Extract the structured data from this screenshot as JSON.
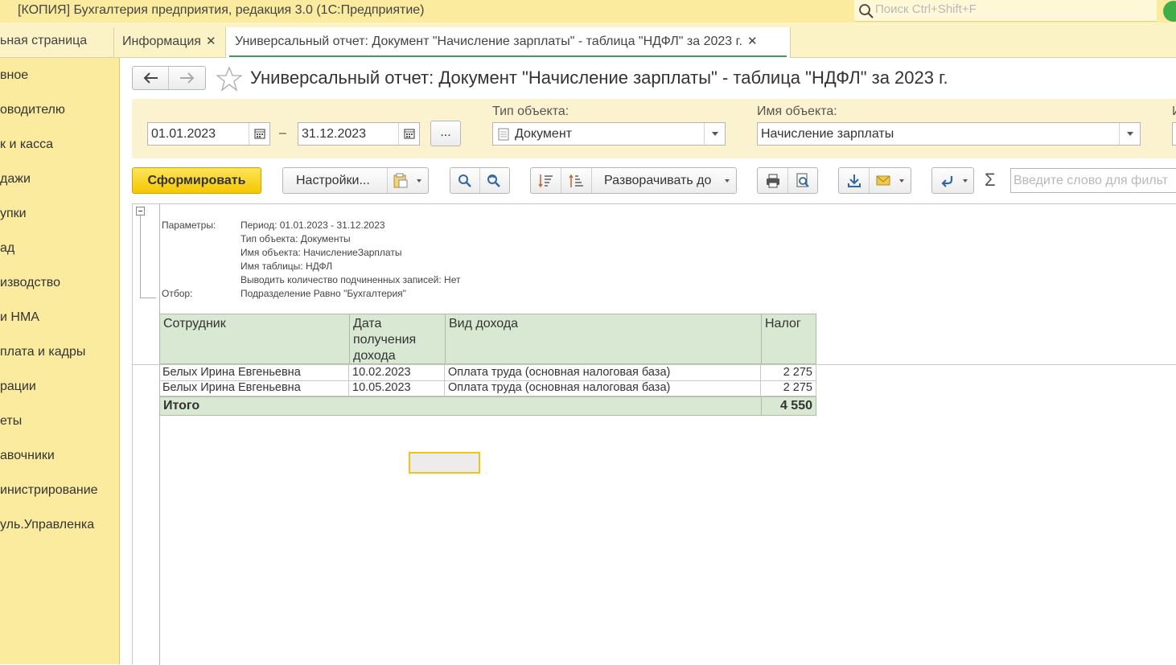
{
  "window": {
    "title": "[КОПИЯ] Бухгалтерия предприятия, редакция 3.0  (1С:Предприятие)",
    "search_placeholder": "Поиск Ctrl+Shift+F"
  },
  "tabs": [
    {
      "label": "ьная страница"
    },
    {
      "label": "Информация",
      "close": "✕"
    },
    {
      "label": "Универсальный отчет: Документ \"Начисление зарплаты\" - таблица \"НДФЛ\" за 2023 г.",
      "close": "✕",
      "active": true
    }
  ],
  "sidebar": {
    "items": [
      {
        "label": "вное"
      },
      {
        "label": "оводителю"
      },
      {
        "label": "к и касса"
      },
      {
        "label": "дажи"
      },
      {
        "label": "упки"
      },
      {
        "label": "ад"
      },
      {
        "label": "изводство"
      },
      {
        "label": "и НМА"
      },
      {
        "label": "плата и кадры"
      },
      {
        "label": "рации"
      },
      {
        "label": "еты"
      },
      {
        "label": "авочники"
      },
      {
        "label": "инистрирование"
      },
      {
        "label": "уль.Управленка"
      }
    ]
  },
  "report": {
    "title": "Универсальный отчет: Документ \"Начисление зарплаты\" - таблица \"НДФЛ\" за 2023 г.",
    "params": {
      "date_from": "01.01.2023",
      "date_separator": "–",
      "date_to": "31.12.2023",
      "more_button": "...",
      "object_type_label": "Тип объекта:",
      "object_type_value": "Документ",
      "object_name_label": "Имя объекта:",
      "object_name_value": "Начисление зарплаты",
      "cut_label": "И"
    },
    "toolbar": {
      "generate": "Сформировать",
      "settings": "Настройки...",
      "expand_to": "Разворачивать до",
      "filter_placeholder": "Введите слово для фильт",
      "sigma": "Σ"
    },
    "header_block": {
      "params_label": "Параметры:",
      "filter_label": "Отбор:",
      "lines": [
        "Период: 01.01.2023 - 31.12.2023",
        "Тип объекта: Документы",
        "Имя объекта: НачислениеЗарплаты",
        "Имя таблицы: НДФЛ",
        "Выводить количество подчиненных записей: Нет"
      ],
      "filter_value": "Подразделение Равно \"Бухгалтерия\""
    },
    "table": {
      "columns": [
        "Сотрудник",
        "Дата получения дохода",
        "Вид дохода",
        "Налог"
      ],
      "rows": [
        [
          "Белых Ирина Евгеньевна",
          "10.02.2023",
          "Оплата труда (основная налоговая база)",
          "2 275"
        ],
        [
          "Белых Ирина Евгеньевна",
          "10.05.2023",
          "Оплата труда (основная налоговая база)",
          "2 275"
        ]
      ],
      "total_label": "Итого",
      "total_value": "4 550"
    }
  },
  "colors": {
    "sidebar_bg": "#fbeb9e",
    "primary_button": "#f5c800",
    "table_header_bg": "#d8e8d2",
    "selection_border": "#f0c419"
  }
}
